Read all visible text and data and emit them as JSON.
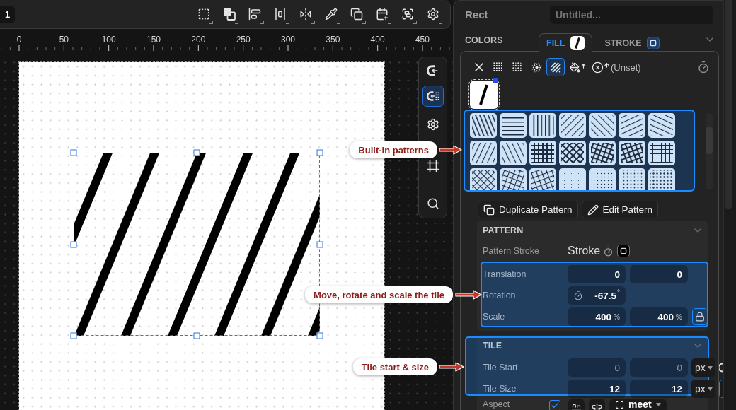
{
  "toolbar": {
    "page_number": "1"
  },
  "ruler": {
    "labels": [
      "0",
      "50",
      "100",
      "150",
      "200",
      "250",
      "300",
      "350",
      "400",
      "450"
    ]
  },
  "canvas_tools": [
    {
      "selected": false
    },
    {
      "selected": true
    },
    {
      "selected": false
    },
    {
      "selected": false
    },
    {
      "selected": false
    }
  ],
  "callouts": [
    {
      "text": "Built-in patterns"
    },
    {
      "text": "Move, rotate and scale the tile"
    },
    {
      "text": "Tile start & size"
    }
  ],
  "inspector": {
    "type_label": "Rect",
    "name_field": {
      "placeholder": "Untitled..."
    },
    "section_title": "COLORS",
    "tabs": [
      {
        "label": "FILL",
        "selected": true
      },
      {
        "label": "STROKE",
        "selected": false
      }
    ],
    "fill_types": [
      {
        "selected": false
      },
      {
        "selected": false
      },
      {
        "selected": false
      },
      {
        "selected": false
      },
      {
        "selected": true
      },
      {
        "selected": false
      },
      {
        "selected": false
      }
    ],
    "fill_status": "(Unset)",
    "actions": [
      "Duplicate Pattern",
      "Edit Pattern"
    ],
    "pattern": {
      "title": "PATTERN",
      "stroke_label": "Pattern Stroke",
      "stroke_value": "Stroke",
      "rows": [
        {
          "label": "Translation",
          "kind": "pair",
          "values": [
            "0",
            "0"
          ]
        },
        {
          "label": "Rotation",
          "kind": "angle",
          "value": "-67.5",
          "unit": "°"
        },
        {
          "label": "Scale",
          "kind": "pair",
          "values": [
            "400",
            "400"
          ],
          "unit": "%",
          "locked": true
        }
      ]
    },
    "tile": {
      "title": "TILE",
      "rows": [
        {
          "label": "Tile Start",
          "placeholders": [
            "0",
            "0"
          ],
          "unit": "px"
        },
        {
          "label": "Tile Size",
          "values": [
            "12",
            "12"
          ],
          "unit": "px"
        }
      ]
    },
    "aspect": {
      "label": "Aspect",
      "checked": true,
      "mode": "meet"
    }
  }
}
